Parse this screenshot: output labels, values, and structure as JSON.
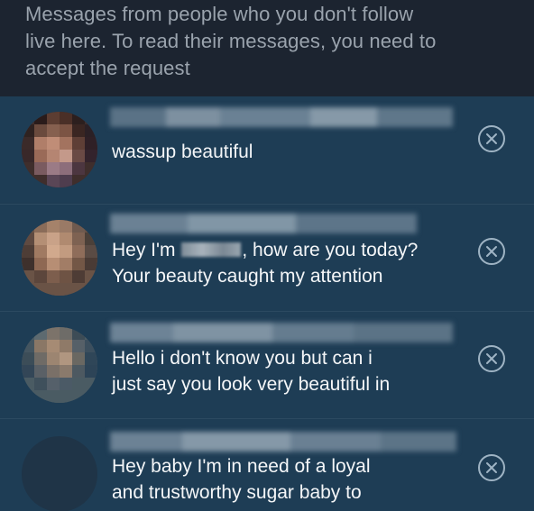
{
  "notice": {
    "lines": [
      "Messages from people who you don't follow",
      "live here. To read their messages, you need to",
      "accept the request"
    ]
  },
  "requests": [
    {
      "message_lines": [
        "wassup beautiful"
      ],
      "close_icon": "x-circle-icon"
    },
    {
      "message_lines": [
        "Hey I'm ",
        ", how are you today?",
        "Your beauty caught my attention"
      ],
      "close_icon": "x-circle-icon"
    },
    {
      "message_lines": [
        "Hello i don't know you but can i",
        "just say you look very beautiful in"
      ],
      "close_icon": "x-circle-icon"
    },
    {
      "message_lines": [
        "Hey baby I'm in need of a loyal",
        "and trustworthy sugar baby to"
      ],
      "close_icon": "x-circle-icon"
    }
  ],
  "colors": {
    "notice_bg": "#1c2430",
    "row_bg": "#1e3d55",
    "message_text": "#f4f6f8",
    "notice_text": "#9aa3ad",
    "close_icon": "#9fb4c4"
  }
}
